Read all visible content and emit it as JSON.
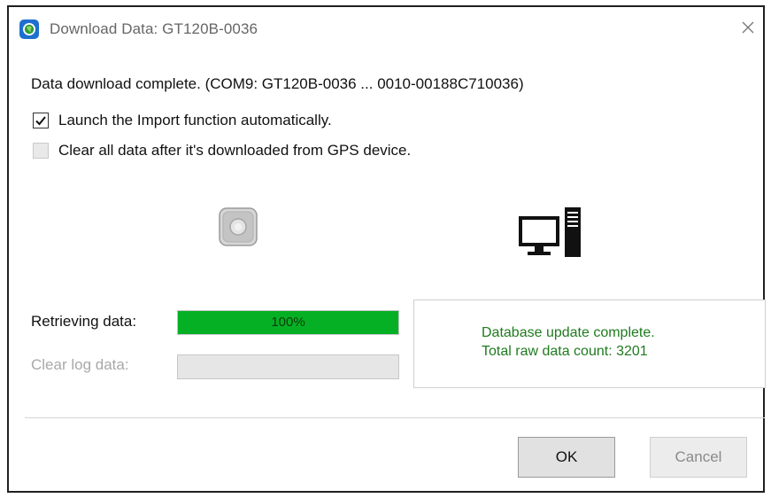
{
  "window": {
    "title": "Download Data: GT120B-0036",
    "app_icon": "globe-logo-icon",
    "close_icon": "close-icon"
  },
  "status": "Data download complete. (COM9: GT120B-0036 ... 0010-00188C710036)",
  "options": [
    {
      "label": "Launch the Import function automatically.",
      "checked": true,
      "enabled": true
    },
    {
      "label": "Clear all data after it's downloaded from GPS device.",
      "checked": false,
      "enabled": false
    }
  ],
  "devices": {
    "gps_icon": "gps-device-icon",
    "pc_icon": "desktop-computer-icon"
  },
  "progress": [
    {
      "label": "Retrieving data:",
      "percent_text": "100%",
      "fraction": 1.0,
      "enabled": true
    },
    {
      "label": "Clear log data:",
      "percent_text": "",
      "fraction": 0.0,
      "enabled": false
    }
  ],
  "result": {
    "line1": "Database update complete.",
    "line2": "Total raw data count: 3201"
  },
  "buttons": {
    "ok": "OK",
    "cancel": "Cancel"
  },
  "colors": {
    "progress_fill": "#06b025",
    "result_text": "#1f7a1f",
    "window_border": "#202020"
  }
}
